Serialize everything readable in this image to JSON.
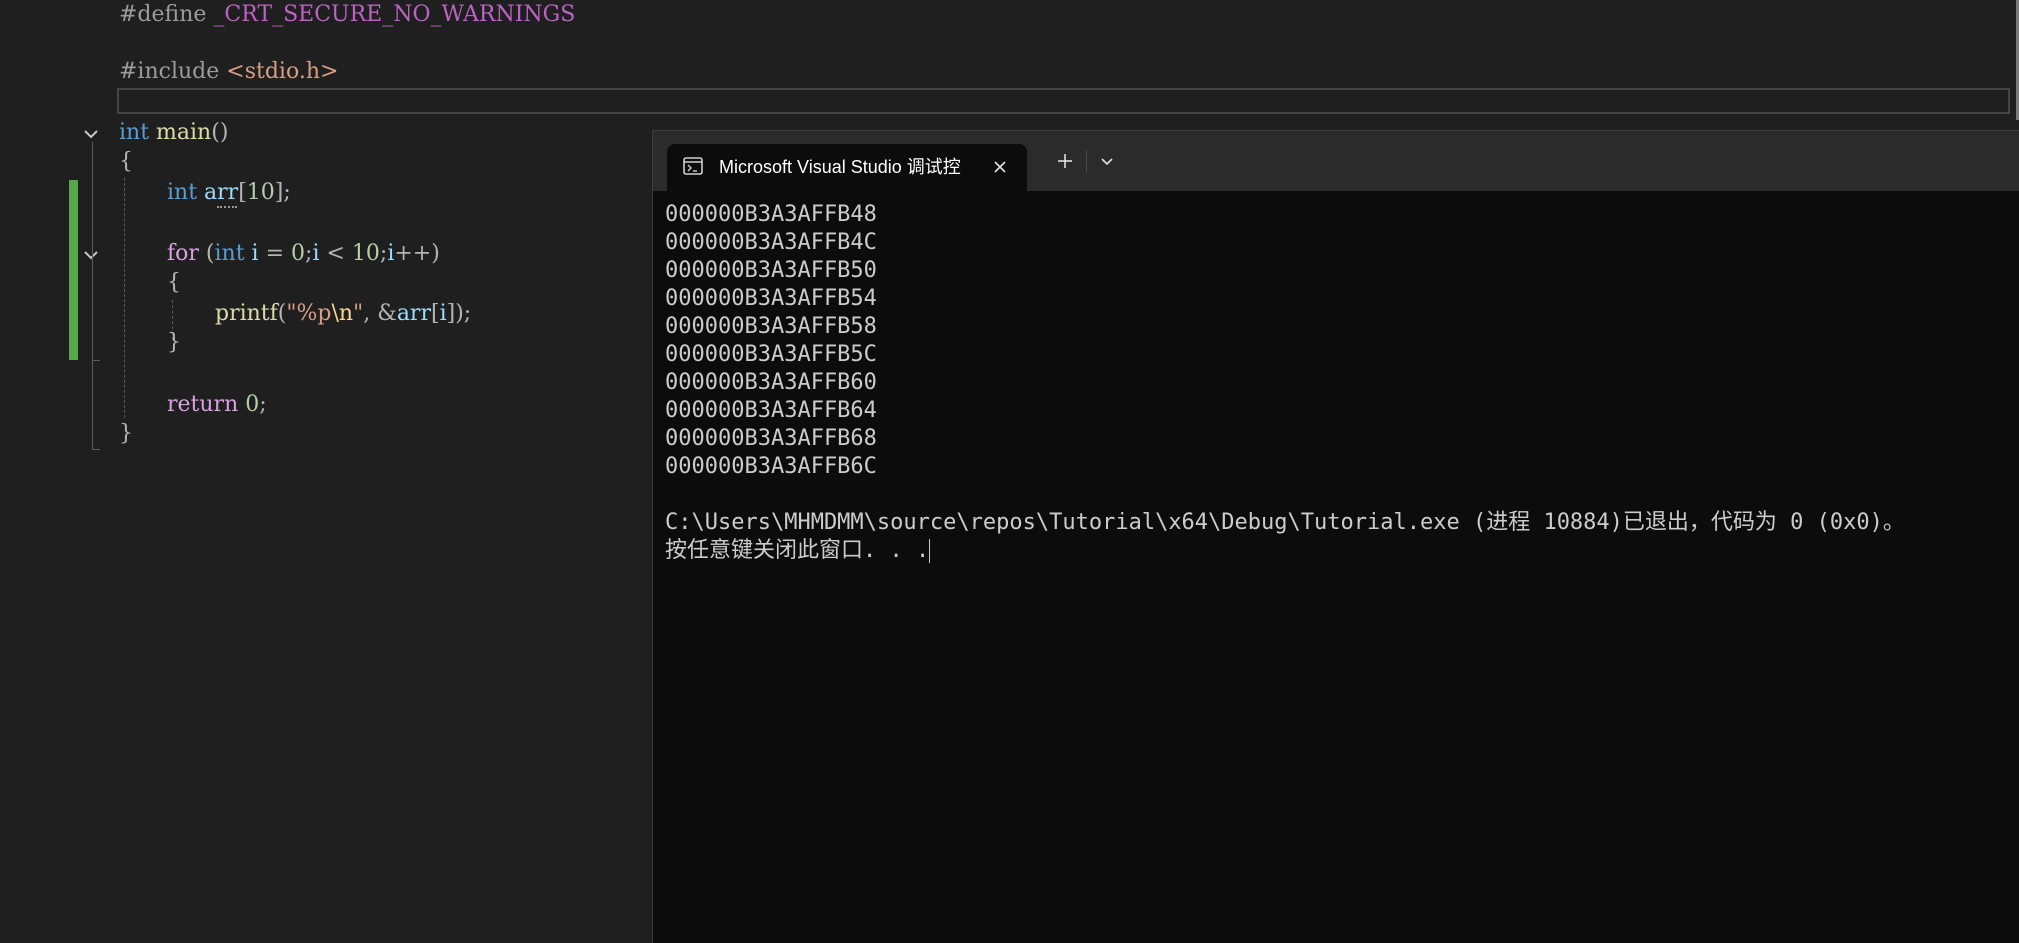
{
  "editor": {
    "lines": {
      "define_kw": "#define",
      "define_name": "_CRT_SECURE_NO_WARNINGS",
      "include_kw": "#include",
      "include_header": "<stdio.h>",
      "main_type": "int",
      "main_name": "main",
      "main_parens": "()",
      "brace_open": "{",
      "arr_type": "int",
      "arr_name": "arr",
      "arr_dim_open": "[",
      "arr_dim": "10",
      "arr_dim_close": "];",
      "for_kw": "for",
      "for_paren_open": "(",
      "for_type": "int",
      "for_var": "i",
      "for_assign": " = ",
      "for_init": "0",
      "for_sep1": ";",
      "for_cond_var": "i",
      "for_lt": " < ",
      "for_limit": "10",
      "for_sep2": ";",
      "for_inc_var": "i",
      "for_inc": "++)",
      "inner_brace_open": "{",
      "printf_name": "printf",
      "printf_open": "(",
      "printf_str_open": "\"%p",
      "printf_esc": "\\n",
      "printf_str_close": "\"",
      "printf_comma": ", ",
      "printf_amp": "&",
      "printf_arr": "arr",
      "printf_idx_open": "[",
      "printf_idx": "i",
      "printf_close": "]);",
      "inner_brace_close": "}",
      "return_kw": "return",
      "return_val": "0",
      "return_semi": ";",
      "brace_close": "}"
    }
  },
  "terminal": {
    "tab_title": "Microsoft Visual Studio 调试控",
    "output": [
      "000000B3A3AFFB48",
      "000000B3A3AFFB4C",
      "000000B3A3AFFB50",
      "000000B3A3AFFB54",
      "000000B3A3AFFB58",
      "000000B3A3AFFB5C",
      "000000B3A3AFFB60",
      "000000B3A3AFFB64",
      "000000B3A3AFFB68",
      "000000B3A3AFFB6C"
    ],
    "exit_message": "C:\\Users\\MHMDMM\\source\\repos\\Tutorial\\x64\\Debug\\Tutorial.exe (进程 10884)已退出，代码为 0 (0x0)。",
    "prompt": "按任意键关闭此窗口. . ."
  },
  "colors": {
    "editor_bg": "#1f1f1f",
    "terminal_bg": "#0c0c0c",
    "change_bar": "#57a64a",
    "keyword": "#569cd6",
    "control": "#d8a0df",
    "function": "#dcdcaa",
    "variable": "#9cdcfe",
    "number": "#b5cea8",
    "string": "#d69d85",
    "macro": "#bd63c5"
  },
  "icons": {
    "fold": "chevron-down-icon",
    "tab": "terminal-icon",
    "close": "close-icon",
    "new_tab": "plus-icon",
    "dropdown": "chevron-down-icon"
  }
}
